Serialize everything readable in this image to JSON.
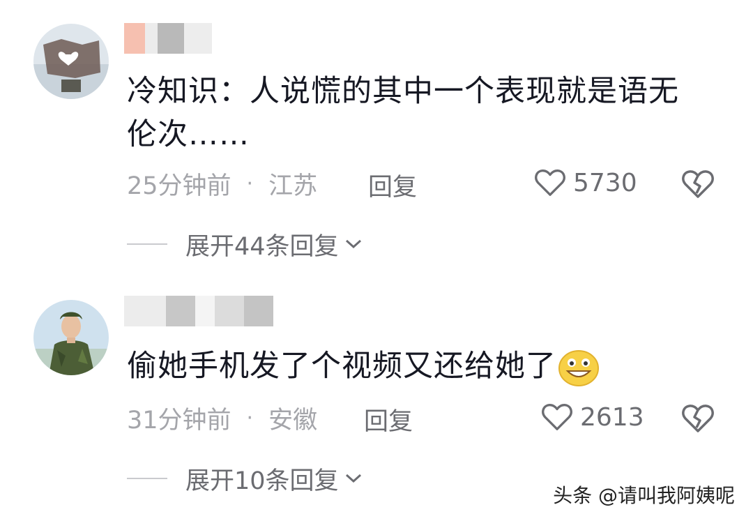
{
  "comments": [
    {
      "text_line1": "冷知识：人说慌的其中一个表现就是语无",
      "text_line2": "伦次……",
      "time": "25分钟前",
      "location": "江苏",
      "reply_label": "回复",
      "likes": "5730",
      "expand_label": "展开44条回复"
    },
    {
      "text": "偷她手机发了个视频又还给她了",
      "time": "31分钟前",
      "location": "安徽",
      "reply_label": "回复",
      "likes": "2613",
      "expand_label": "展开10条回复"
    }
  ],
  "meta_separator": "·",
  "watermark": "头条 @请叫我阿姨呢",
  "colors": {
    "text": "#161823",
    "muted": "#a4a5aa",
    "secondary": "#6b6c71"
  },
  "icons": [
    "heart-icon",
    "broken-heart-icon",
    "chevron-down-icon",
    "grin-emoji-icon"
  ]
}
